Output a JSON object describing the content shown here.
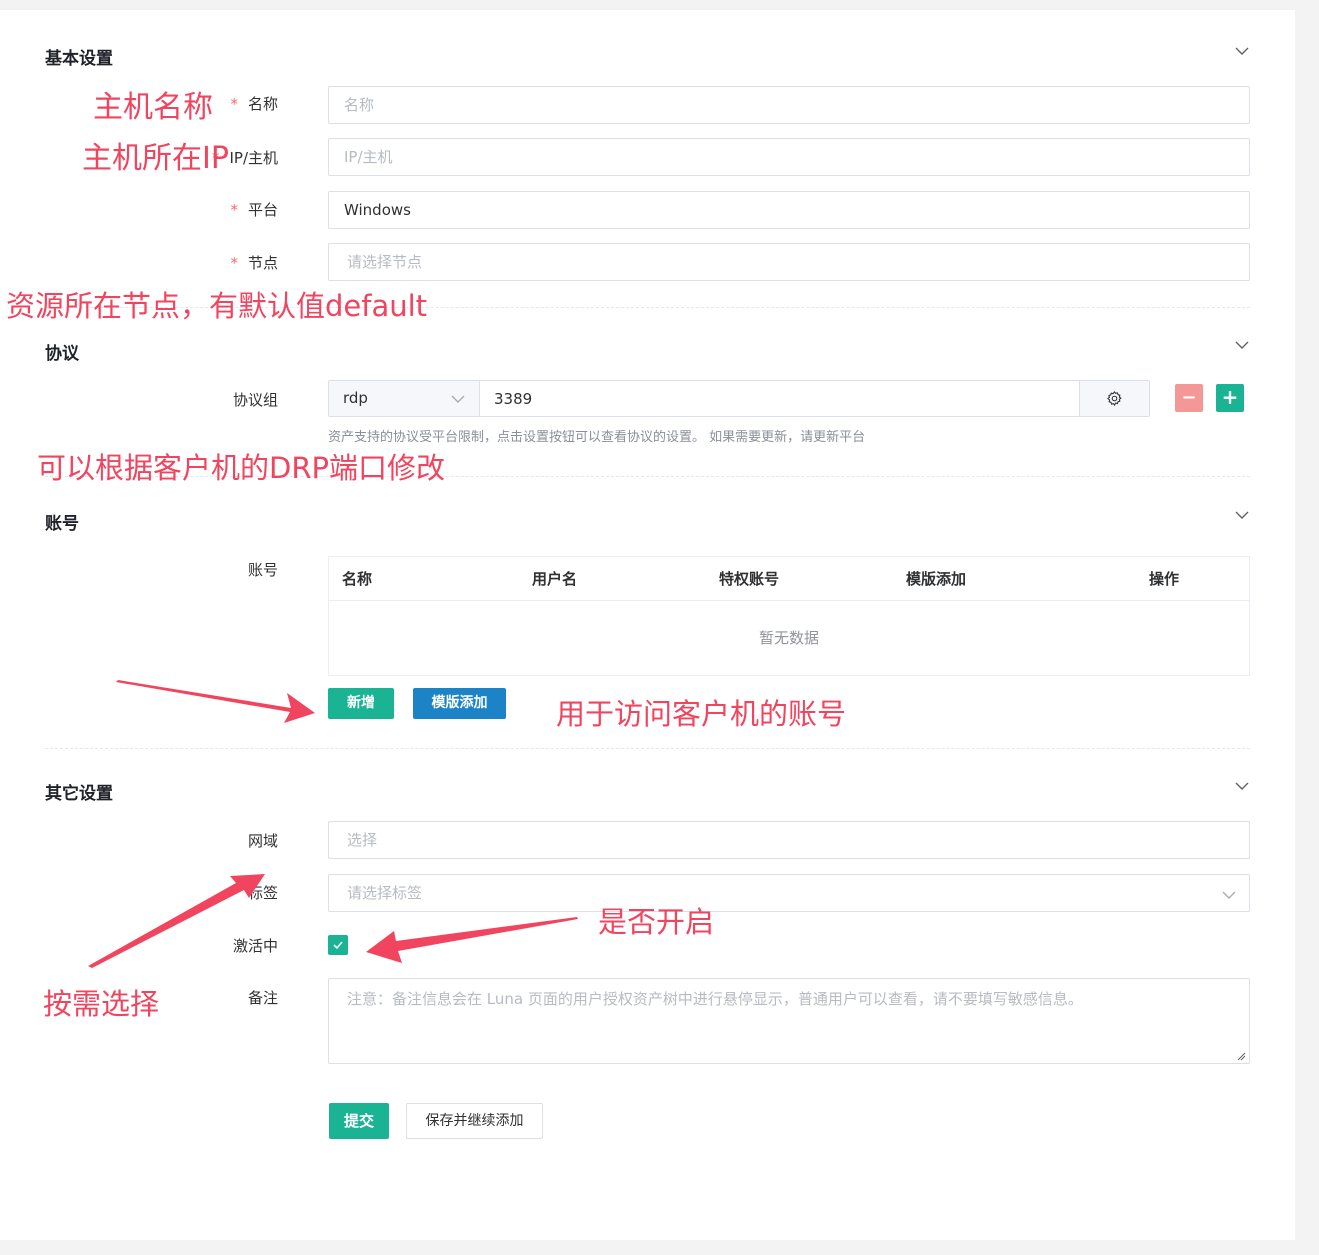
{
  "sections": {
    "basic": {
      "title": "基本设置"
    },
    "protocol": {
      "title": "协议"
    },
    "account": {
      "title": "账号"
    },
    "other": {
      "title": "其它设置"
    }
  },
  "basic": {
    "name": {
      "label": "名称",
      "placeholder": "名称",
      "value": "",
      "required": "*"
    },
    "ip": {
      "label": "IP/主机",
      "placeholder": "IP/主机",
      "value": "",
      "required": "*"
    },
    "platform": {
      "label": "平台",
      "value": "Windows",
      "required": "*"
    },
    "node": {
      "label": "节点",
      "placeholder": "请选择节点",
      "value": "",
      "required": "*"
    }
  },
  "protocol": {
    "label": "协议组",
    "type": "rdp",
    "port": "3389",
    "help": "资产支持的协议受平台限制，点击设置按钮可以查看协议的设置。 如果需要更新，请更新平台",
    "remove_symbol": "−",
    "add_symbol": "+"
  },
  "account": {
    "label": "账号",
    "columns": [
      "名称",
      "用户名",
      "特权账号",
      "模版添加",
      "操作"
    ],
    "empty_text": "暂无数据",
    "add_button": "新增",
    "template_button": "模版添加"
  },
  "other": {
    "domain": {
      "label": "网域",
      "placeholder": "选择"
    },
    "labels": {
      "label": "标签",
      "placeholder": "请选择标签"
    },
    "active": {
      "label": "激活中",
      "checked": true
    },
    "comment": {
      "label": "备注",
      "placeholder": "注意：备注信息会在 Luna 页面的用户授权资产树中进行悬停显示，普通用户可以查看，请不要填写敏感信息。"
    }
  },
  "actions": {
    "submit": "提交",
    "save_continue": "保存并继续添加"
  },
  "annotations": {
    "hostname": "主机名称",
    "host_ip": "主机所在IP",
    "node_note": "资源所在节点，有默认值default",
    "port_note": "可以根据客户机的DRP端口修改",
    "account_note": "用于访问客户机的账号",
    "toggle_note": "是否开启",
    "select_note": "按需选择"
  },
  "colors": {
    "primary": "#1ab394",
    "info": "#1c84c6",
    "danger": "#f56c6c",
    "annotation": "#f0445f"
  }
}
